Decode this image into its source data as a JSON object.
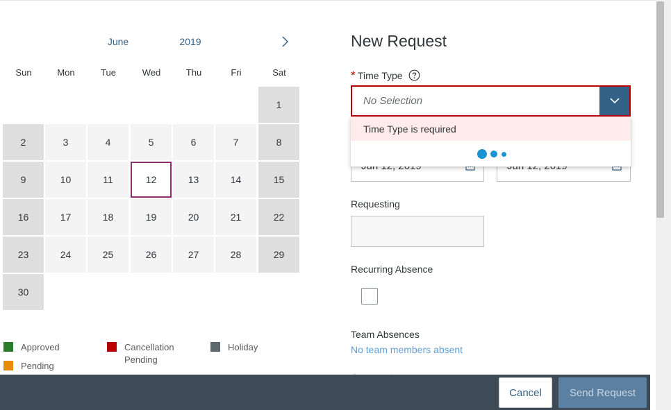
{
  "calendar": {
    "month": "June",
    "year": "2019",
    "weekdays": [
      "Sun",
      "Mon",
      "Tue",
      "Wed",
      "Thu",
      "Fri",
      "Sat"
    ],
    "days": [
      "1",
      "2",
      "3",
      "4",
      "5",
      "6",
      "7",
      "8",
      "9",
      "10",
      "11",
      "12",
      "13",
      "14",
      "15",
      "16",
      "17",
      "18",
      "19",
      "20",
      "21",
      "22",
      "23",
      "24",
      "25",
      "26",
      "27",
      "28",
      "29",
      "30"
    ],
    "selected_day": "12"
  },
  "legend": {
    "approved": {
      "label": "Approved",
      "color": "#2b7d2b"
    },
    "cancellation_pending": {
      "label": "Cancellation Pending",
      "line1": "Cancellation",
      "line2": "Pending",
      "color": "#bb0000"
    },
    "holiday": {
      "label": "Holiday",
      "color": "#5e696e"
    },
    "pending": {
      "label": "Pending",
      "color": "#e78c07"
    }
  },
  "form": {
    "title": "New Request",
    "time_type": {
      "required_marker": "*",
      "label": "Time Type",
      "value": "No Selection",
      "error": "Time Type is required"
    },
    "start_date": "Jun 12, 2019",
    "end_date": "Jun 12, 2019",
    "requesting_label": "Requesting",
    "recurring_label": "Recurring Absence",
    "team_absences_label": "Team Absences",
    "team_absences_link": "No team members absent",
    "comment_label": "Comment"
  },
  "footer": {
    "cancel_label": "Cancel",
    "send_label": "Send Request"
  }
}
